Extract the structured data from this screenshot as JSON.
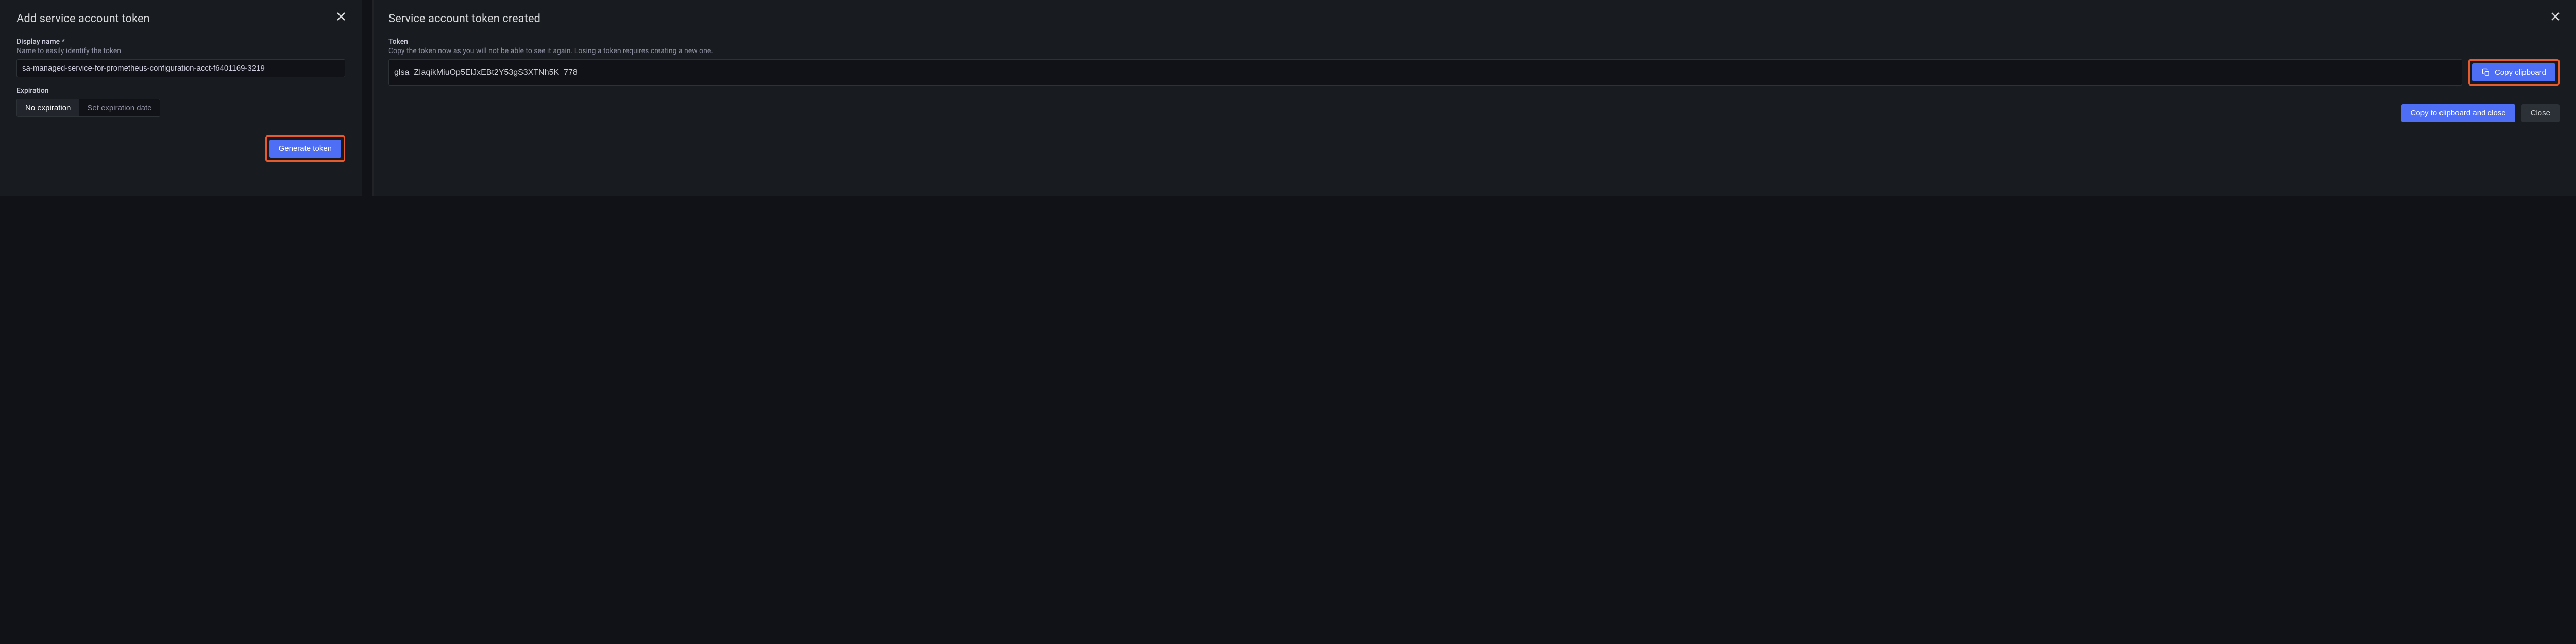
{
  "left": {
    "title": "Add service account token",
    "display_name": {
      "label": "Display name *",
      "help": "Name to easily identify the token",
      "value": "sa-managed-service-for-prometheus-configuration-acct-f6401169-3219"
    },
    "expiration": {
      "label": "Expiration",
      "options": [
        "No expiration",
        "Set expiration date"
      ],
      "selected_index": 0
    },
    "generate_label": "Generate token"
  },
  "right": {
    "title": "Service account token created",
    "token_section": {
      "label": "Token",
      "help": "Copy the token now as you will not be able to see it again. Losing a token requires creating a new one.",
      "value": "glsa_ZIaqikMiuOp5ElJxEBt2Y53gS3XTNh5K_778"
    },
    "copy_label": "Copy clipboard",
    "copy_close_label": "Copy to clipboard and close",
    "close_label": "Close"
  }
}
